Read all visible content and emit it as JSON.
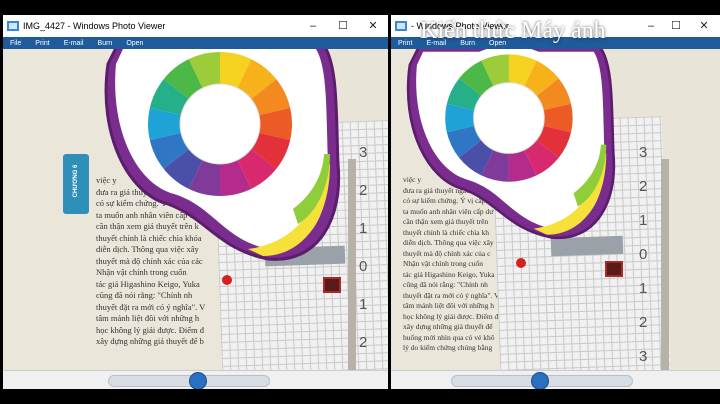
{
  "left_window": {
    "title": "IMG_4427 - Windows Photo Viewer",
    "controls": [
      "–",
      "☐",
      "✕"
    ],
    "menu": [
      "File",
      "Print",
      "E-mail",
      "Burn",
      "Open"
    ],
    "chapter_tab": "CHƯƠNG 6",
    "page_lines": [
      "việc y",
      "đưa ra giả thuyết ngẫu nhiên, đo",
      "có sự kiểm chứng. Ý vị cấp trên",
      "ta muốn anh nhân viên cấp dư",
      "cần thận xem giả thuyết trên k",
      "thuyết chỉnh là chiếc chìa khóa",
      "diễn dịch. Thông qua việc xây",
      "thuyết mà độ chính xác của các",
      "Nhận vật chính trong cuốn",
      "tác giả Higashino Keigo, Yuka",
      "cũng đã nói rằng: \"Chính nh",
      "thuyết đặt ra mới có ý nghĩa\". V",
      "tâm mảnh liệt đôi với những h",
      "học không lý giải được. Điểm đ",
      "xây dựng những giả thuyết để b"
    ],
    "grid_numbers": [
      "3",
      "2",
      "1",
      "0",
      "1",
      "2"
    ]
  },
  "right_window": {
    "title": "- Windows Photo Viewer",
    "controls": [
      "–",
      "☐",
      "✕"
    ],
    "menu": [
      "Print",
      "E-mail",
      "Burn",
      "Open"
    ],
    "page_lines": [
      "việc y",
      "đưa ra giả thuyết ngẫu nhiên, đo",
      "có sự kiểm chứng. Ý vị cấp tr",
      "ta muốn anh nhân viên cấp dư",
      "cần thận xem giả thuyết trên",
      "thuyết chỉnh là chiếc chìa kh",
      "diễn dịch. Thông qua việc xây",
      "thuyết mà độ chính xác của c",
      "Nhận vật chính trong cuốn",
      "tác giả Higashino Keigo, Yuka",
      "cũng đã nói rằng: \"Chính nh",
      "thuyết đặt ra mới có ý nghĩa\". V",
      "tâm mảnh liệt đôi với những h",
      "học không lý giải được. Điểm đ",
      "xây dựng những giả thuyết để",
      "huống mới nhìn qua có vẻ khô",
      "lý do kiểm chứng chúng bằng"
    ],
    "grid_numbers": [
      "3",
      "2",
      "1",
      "0",
      "1",
      "2",
      "3"
    ]
  },
  "watermark": "Kiến thức Máy ảnh",
  "colors": {
    "menubar": "#1f5a9a",
    "red_marker": "#d62020",
    "wheel_frame": "#7a2d8f"
  }
}
